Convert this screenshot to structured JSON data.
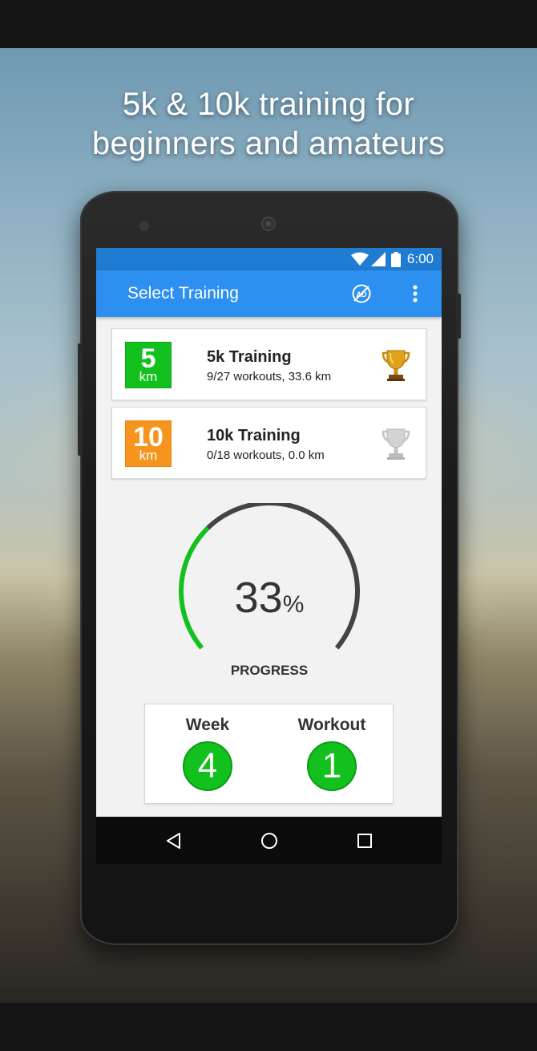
{
  "promo": {
    "headline_line1": "5k & 10k training for",
    "headline_line2": "beginners and amateurs"
  },
  "statusbar": {
    "time": "6:00",
    "icons": [
      "wifi-icon",
      "cell-signal-icon",
      "battery-icon"
    ]
  },
  "appbar": {
    "title": "Select Training",
    "actions": [
      "remove-ads-icon",
      "more-options-icon"
    ],
    "color": "#2d8ff0"
  },
  "trainings": [
    {
      "badge_number": "5",
      "badge_unit": "km",
      "badge_color": "#12c11e",
      "name": "5k Training",
      "stats": "9/27 workouts, 33.6 km",
      "trophy": "gold"
    },
    {
      "badge_number": "10",
      "badge_unit": "km",
      "badge_color": "#f7941d",
      "name": "10k Training",
      "stats": "0/18 workouts, 0.0 km",
      "trophy": "silver"
    }
  ],
  "progress": {
    "value": "33",
    "unit": "%",
    "label": "PROGRESS",
    "fraction": 0.33,
    "fill_color": "#12c11e",
    "track_color": "#444444"
  },
  "current": {
    "week_label": "Week",
    "week_value": "4",
    "workout_label": "Workout",
    "workout_value": "1"
  },
  "navbar": {
    "buttons": [
      "back-icon",
      "home-icon",
      "recents-icon"
    ]
  }
}
